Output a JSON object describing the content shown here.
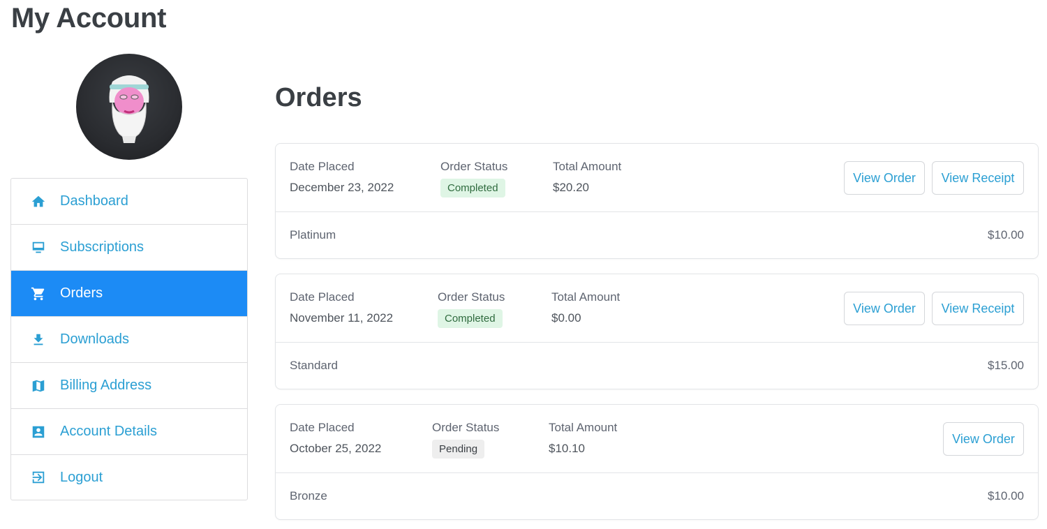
{
  "page": {
    "title": "My Account"
  },
  "sidebar": {
    "items": [
      {
        "label": "Dashboard",
        "icon": "home-icon",
        "active": false
      },
      {
        "label": "Subscriptions",
        "icon": "monitor-icon",
        "active": false
      },
      {
        "label": "Orders",
        "icon": "cart-icon",
        "active": true
      },
      {
        "label": "Downloads",
        "icon": "download-icon",
        "active": false
      },
      {
        "label": "Billing Address",
        "icon": "map-icon",
        "active": false
      },
      {
        "label": "Account Details",
        "icon": "contact-card-icon",
        "active": false
      },
      {
        "label": "Logout",
        "icon": "logout-icon",
        "active": false
      }
    ]
  },
  "orders": {
    "title": "Orders",
    "headers": {
      "date": "Date Placed",
      "status": "Order Status",
      "total": "Total Amount"
    },
    "list": [
      {
        "date": "December 23, 2022",
        "status": "Completed",
        "total": "$20.20",
        "product": "Platinum",
        "price": "$10.00",
        "buttons": {
          "view_order": "View Order",
          "view_receipt": "View Receipt"
        }
      },
      {
        "date": "November 11, 2022",
        "status": "Completed",
        "total": "$0.00",
        "product": "Standard",
        "price": "$15.00",
        "buttons": {
          "view_order": "View Order",
          "view_receipt": "View Receipt"
        }
      },
      {
        "date": "October 25, 2022",
        "status": "Pending",
        "total": "$10.10",
        "product": "Bronze",
        "price": "$10.00",
        "buttons": {
          "view_order": "View Order"
        }
      }
    ]
  },
  "colors": {
    "accent": "#2b9fd3",
    "active_bg": "#1c8bf5",
    "completed_bg": "#dff5e5",
    "pending_bg": "#eeeeee"
  }
}
